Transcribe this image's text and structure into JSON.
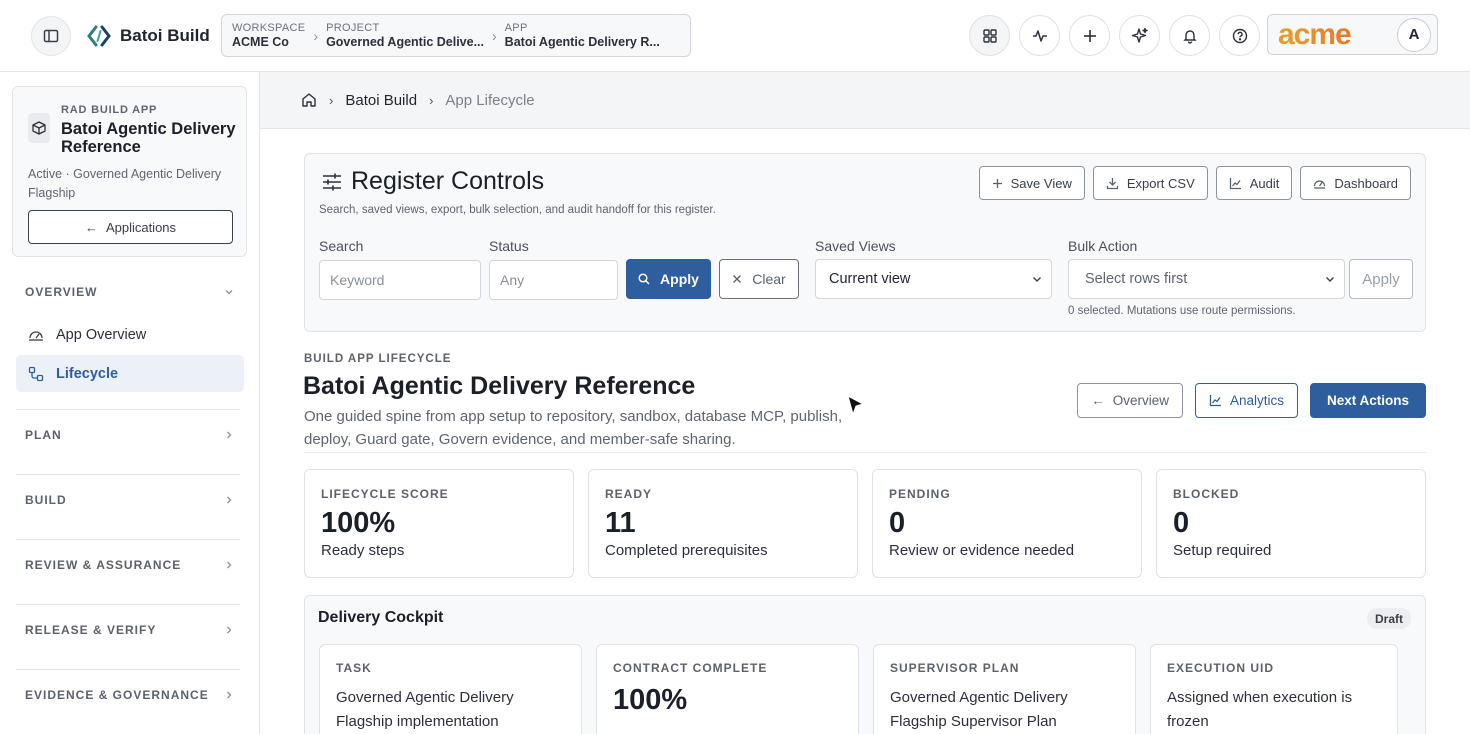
{
  "topbar": {
    "brand": "Batoi Build",
    "breadcrumb": [
      {
        "label": "WORKSPACE",
        "value": "ACME Co"
      },
      {
        "label": "PROJECT",
        "value": "Governed Agentic Delive..."
      },
      {
        "label": "APP",
        "value": "Batoi Agentic Delivery R..."
      }
    ],
    "icons": [
      "grid-icon",
      "activity-icon",
      "plus-icon",
      "sparkle-icon",
      "bell-icon",
      "help-icon"
    ],
    "org_logo_text": "acme",
    "avatar_initial": "A"
  },
  "sidebar": {
    "app_kicker": "RAD BUILD APP",
    "app_title": "Batoi Agentic Delivery Reference",
    "app_desc": "Active · Governed Agentic Delivery Flagship",
    "applications_label": "Applications",
    "sections": [
      {
        "label": "OVERVIEW",
        "expanded": true
      },
      {
        "label": "PLAN"
      },
      {
        "label": "BUILD"
      },
      {
        "label": "REVIEW & ASSURANCE"
      },
      {
        "label": "RELEASE & VERIFY"
      },
      {
        "label": "EVIDENCE & GOVERNANCE"
      }
    ],
    "items": [
      {
        "label": "App Overview",
        "active": false
      },
      {
        "label": "Lifecycle",
        "active": true
      }
    ]
  },
  "main_breadcrumb": {
    "root": "Batoi Build",
    "current": "App Lifecycle"
  },
  "register": {
    "title": "Register Controls",
    "subtitle": "Search, saved views, export, bulk selection, and audit handoff for this register.",
    "actions": [
      "Save View",
      "Export CSV",
      "Audit",
      "Dashboard"
    ],
    "search_label": "Search",
    "search_placeholder": "Keyword",
    "status_label": "Status",
    "status_placeholder": "Any",
    "apply_label": "Apply",
    "clear_label": "Clear",
    "saved_views_label": "Saved Views",
    "saved_views_value": "Current view",
    "bulk_label": "Bulk Action",
    "bulk_value": "Select rows first",
    "bulk_apply": "Apply",
    "note": "0 selected. Mutations use route permissions."
  },
  "lifecycle": {
    "kicker": "BUILD APP LIFECYCLE",
    "title": "Batoi Agentic Delivery Reference",
    "desc": "One guided spine from app setup to repository, sandbox, database MCP, publish, deploy, Guard gate, Govern evidence, and member-safe sharing.",
    "actions": {
      "overview": "Overview",
      "analytics": "Analytics",
      "next": "Next Actions"
    },
    "stats": [
      {
        "label": "LIFECYCLE SCORE",
        "value": "100%",
        "hint": "Ready steps"
      },
      {
        "label": "READY",
        "value": "11",
        "hint": "Completed prerequisites"
      },
      {
        "label": "PENDING",
        "value": "0",
        "hint": "Review or evidence needed"
      },
      {
        "label": "BLOCKED",
        "value": "0",
        "hint": "Setup required"
      }
    ]
  },
  "cockpit": {
    "title": "Delivery Cockpit",
    "badge": "Draft",
    "tiles": [
      {
        "label": "TASK",
        "value": "Governed Agentic Delivery Flagship implementation"
      },
      {
        "label": "CONTRACT COMPLETE",
        "value": "100%"
      },
      {
        "label": "SUPERVISOR PLAN",
        "value": "Governed Agentic Delivery Flagship Supervisor Plan"
      },
      {
        "label": "EXECUTION UID",
        "value": "Assigned when execution is frozen"
      }
    ]
  },
  "colors": {
    "accent": "#2e5e9e",
    "brand_logo": "#e8782e"
  }
}
